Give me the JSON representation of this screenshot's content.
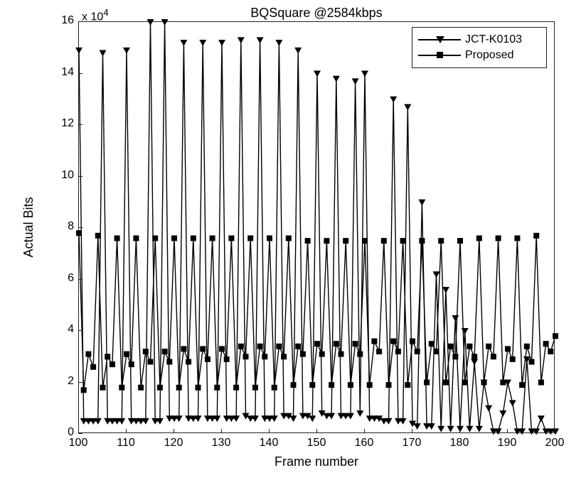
{
  "chart_data": {
    "type": "line",
    "title": "BQSquare @2584kbps",
    "xlabel": "Frame number",
    "ylabel": "Actual Bits",
    "y_exp_label": "x 10^4",
    "xlim": [
      100,
      200
    ],
    "ylim": [
      0,
      16
    ],
    "xticks": [
      100,
      110,
      120,
      130,
      140,
      150,
      160,
      170,
      180,
      190,
      200
    ],
    "yticks": [
      0,
      2,
      4,
      6,
      8,
      10,
      12,
      14,
      16
    ],
    "x": [
      100,
      101,
      102,
      103,
      104,
      105,
      106,
      107,
      108,
      109,
      110,
      111,
      112,
      113,
      114,
      115,
      116,
      117,
      118,
      119,
      120,
      121,
      122,
      123,
      124,
      125,
      126,
      127,
      128,
      129,
      130,
      131,
      132,
      133,
      134,
      135,
      136,
      137,
      138,
      139,
      140,
      141,
      142,
      143,
      144,
      145,
      146,
      147,
      148,
      149,
      150,
      151,
      152,
      153,
      154,
      155,
      156,
      157,
      158,
      159,
      160,
      161,
      162,
      163,
      164,
      165,
      166,
      167,
      168,
      169,
      170,
      171,
      172,
      173,
      174,
      175,
      176,
      177,
      178,
      179,
      180,
      181,
      182,
      183,
      184,
      185,
      186,
      187,
      188,
      189,
      190,
      191,
      192,
      193,
      194,
      195,
      196,
      197,
      198,
      199,
      200
    ],
    "series": [
      {
        "name": "JCT-K0103",
        "marker": "triangle_down",
        "values": [
          14.9,
          0.5,
          0.5,
          0.5,
          0.5,
          14.8,
          0.5,
          0.5,
          0.5,
          0.5,
          14.9,
          0.5,
          0.5,
          0.5,
          0.5,
          16.0,
          0.5,
          0.5,
          16.0,
          0.6,
          0.6,
          0.6,
          15.2,
          0.6,
          0.6,
          0.6,
          15.2,
          0.6,
          0.6,
          0.6,
          15.2,
          0.6,
          0.6,
          0.6,
          15.3,
          0.7,
          0.6,
          0.6,
          15.3,
          0.6,
          0.6,
          0.6,
          15.2,
          0.7,
          0.7,
          0.6,
          14.9,
          0.7,
          0.7,
          0.6,
          14.0,
          0.8,
          0.7,
          0.7,
          13.8,
          0.7,
          0.7,
          0.7,
          13.7,
          0.8,
          14.0,
          0.6,
          0.6,
          0.6,
          0.5,
          0.5,
          13.0,
          0.5,
          0.5,
          12.7,
          0.4,
          0.3,
          9.0,
          0.3,
          0.3,
          6.2,
          0.2,
          5.6,
          0.2,
          4.5,
          0.2,
          4.0,
          0.2,
          2.8,
          0.2,
          2.0,
          1.0,
          0.1,
          0.1,
          0.8,
          2.0,
          1.2,
          0.1,
          0.1,
          2.9,
          0.1,
          0.1,
          0.6,
          0.1,
          0.1,
          0.1
        ]
      },
      {
        "name": "Proposed",
        "marker": "square",
        "values": [
          7.8,
          1.7,
          3.1,
          2.6,
          7.7,
          1.8,
          3.0,
          2.7,
          7.6,
          1.8,
          3.1,
          2.7,
          7.6,
          1.8,
          3.2,
          2.8,
          7.6,
          1.8,
          3.2,
          2.8,
          7.6,
          1.8,
          3.3,
          2.8,
          7.6,
          1.8,
          3.3,
          2.9,
          7.6,
          1.8,
          3.3,
          2.9,
          7.6,
          1.8,
          3.4,
          3.0,
          7.6,
          1.8,
          3.4,
          3.0,
          7.6,
          1.8,
          3.4,
          3.0,
          7.6,
          1.9,
          3.4,
          3.1,
          7.5,
          1.9,
          3.5,
          3.1,
          7.5,
          1.9,
          3.5,
          3.1,
          7.5,
          1.9,
          3.5,
          3.1,
          7.5,
          1.9,
          3.6,
          3.2,
          7.5,
          1.9,
          3.6,
          3.2,
          7.5,
          1.9,
          3.6,
          3.2,
          7.5,
          2.0,
          3.5,
          3.2,
          7.5,
          2.0,
          3.4,
          3.0,
          7.5,
          2.0,
          3.4,
          3.0,
          7.6,
          2.0,
          3.4,
          3.0,
          7.6,
          2.0,
          3.3,
          2.9,
          7.6,
          1.9,
          3.4,
          2.8,
          7.7,
          2.0,
          3.5,
          3.2,
          3.8
        ]
      }
    ],
    "legend": {
      "entries": [
        "JCT-K0103",
        "Proposed"
      ],
      "position": "upper right"
    }
  }
}
